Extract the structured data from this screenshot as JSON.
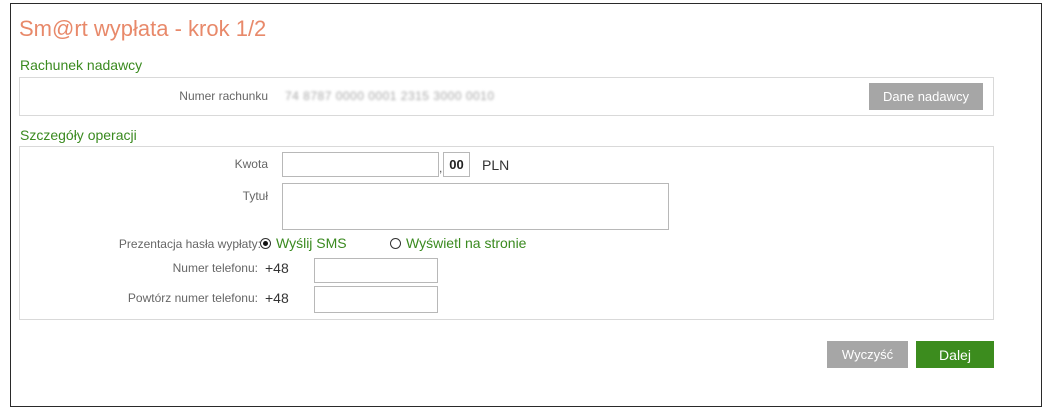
{
  "page": {
    "title": "Sm@rt wypłata - krok 1/2"
  },
  "sender_section": {
    "title": "Rachunek nadawcy",
    "account_label": "Numer rachunku",
    "account_number": "74 8787 0000 0001 2315 3000 0010",
    "sender_button": "Dane nadawcy"
  },
  "details_section": {
    "title": "Szczegóły operacji",
    "amount_label": "Kwota",
    "amount_value": "",
    "amount_separator": ",",
    "amount_cents": "00",
    "currency": "PLN",
    "title_label": "Tytuł",
    "title_value": "",
    "presentation_label": "Prezentacja hasła wypłaty:",
    "presentation_options": [
      {
        "label": "Wyślij SMS",
        "selected": true
      },
      {
        "label": "Wyświetl na stronie",
        "selected": false
      }
    ],
    "phone_label": "Numer telefonu:",
    "phone_prefix": "+48",
    "phone_value": "",
    "phone_repeat_label": "Powtórz numer telefonu:",
    "phone_repeat_prefix": "+48",
    "phone_repeat_value": ""
  },
  "actions": {
    "clear_button": "Wyczyść",
    "next_button": "Dalej"
  },
  "colors": {
    "title": "#e8896a",
    "section_title": "#3a8a1f",
    "button_gray": "#a6a6a6",
    "button_green": "#3c8c1e"
  }
}
